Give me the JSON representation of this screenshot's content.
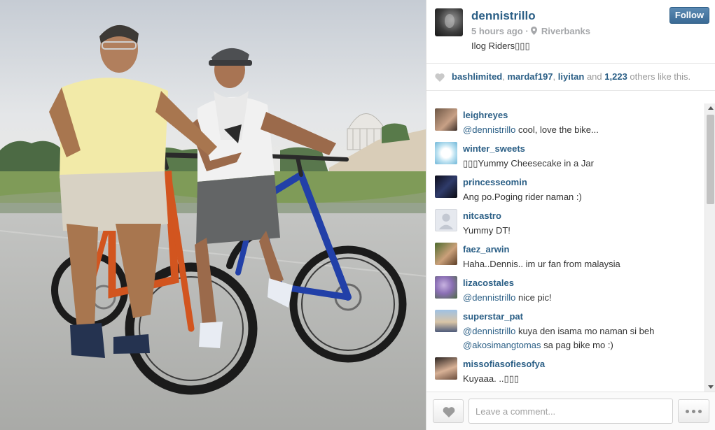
{
  "post": {
    "owner": "dennistrillo",
    "time": "5 hours ago",
    "location": "Riverbanks",
    "caption": "Ilog Riders▯▯▯",
    "follow_label": "Follow",
    "icons": {
      "location": "map-pin-icon",
      "owner_avatar": "profile-photo"
    }
  },
  "likes": {
    "users": [
      "bashlimited",
      "mardaf197",
      "liyitan"
    ],
    "sep1": ", ",
    "sep2": ", ",
    "and_text": " and ",
    "others_count": "1,223",
    "others_text": " others like this.",
    "icon": "heart-icon"
  },
  "comments": [
    {
      "user": "leighreyes",
      "mention": "@dennistrillo",
      "text": " cool, love the bike..."
    },
    {
      "user": "winter_sweets",
      "mention": "",
      "text": "▯▯▯Yummy Cheesecake in a Jar"
    },
    {
      "user": "princesseomin",
      "mention": "",
      "text": "Ang po.Poging rider naman :)"
    },
    {
      "user": "nitcastro",
      "mention": "",
      "text": "Yummy DT!"
    },
    {
      "user": "faez_arwin",
      "mention": "",
      "text": "Haha..Dennis.. im ur fan from malaysia"
    },
    {
      "user": "lizacostales",
      "mention": "@dennistrillo",
      "text": " nice pic!"
    },
    {
      "user": "superstar_pat",
      "mention": "@dennistrillo",
      "text": " kuya den isama mo naman si beh ",
      "mention2": "@akosimangtomas",
      "text2": " sa pag bike mo :)"
    },
    {
      "user": "missofiasofiesofya",
      "mention": "",
      "text": "Kuyaaa. ..▯▯▯"
    }
  ],
  "composer": {
    "placeholder": "Leave a comment...",
    "like_icon": "heart-icon",
    "more_icon": "ellipsis-icon"
  },
  "colors": {
    "link": "#2b5f86",
    "follow_button": "#3a6a95",
    "meta_text": "#a5a7aa"
  }
}
